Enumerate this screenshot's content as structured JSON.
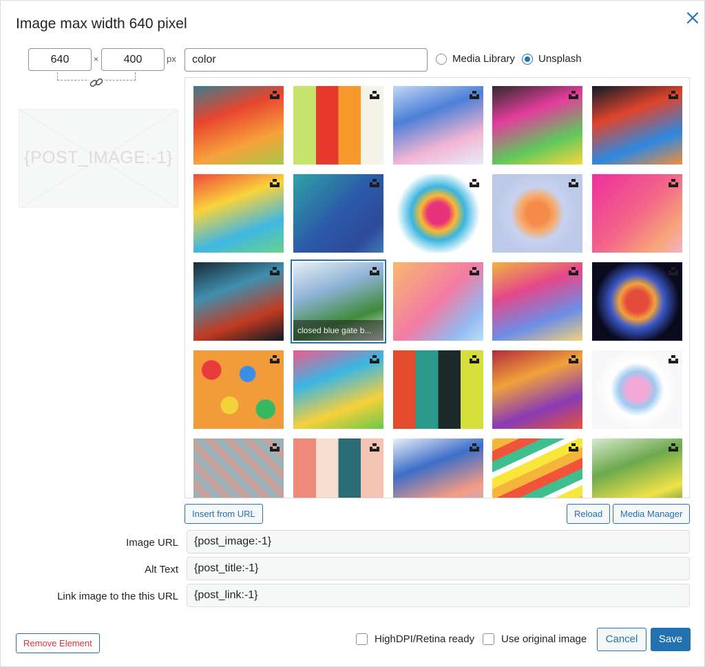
{
  "dialog": {
    "title": "Image max width 640 pixel",
    "close_icon": "close-icon"
  },
  "size": {
    "width": "640",
    "height": "400",
    "times": "×",
    "unit": "px",
    "link_icon": "chain-link-icon"
  },
  "placeholder": {
    "text": "{POST_IMAGE:-1}"
  },
  "search": {
    "value": "color"
  },
  "source": {
    "options": [
      {
        "label": "Media Library",
        "selected": false
      },
      {
        "label": "Unsplash",
        "selected": true
      }
    ]
  },
  "gallery": {
    "badge_icon": "unsplash-logo-icon",
    "selected_caption": "closed blue gate b...",
    "images": [
      {
        "colors": [
          "#3b7c8c",
          "#e8452f",
          "#f7a23b",
          "#a7c84a"
        ],
        "style": "tunnel"
      },
      {
        "colors": [
          "#c6e36b",
          "#e6392b",
          "#f79a2b",
          "#f3f3e8"
        ],
        "style": "stripes"
      },
      {
        "colors": [
          "#bfd8f3",
          "#4d7fd8",
          "#f2b5d3",
          "#e5eef8"
        ],
        "style": "swirl"
      },
      {
        "colors": [
          "#2f2a2a",
          "#e43c9c",
          "#5fc85d",
          "#f7d63b"
        ],
        "style": "windows"
      },
      {
        "colors": [
          "#0d1b2a",
          "#e0442b",
          "#2e88e0",
          "#f28e3b"
        ],
        "style": "smoke"
      },
      {
        "colors": [
          "#f0493a",
          "#f9d33b",
          "#3fb7e3",
          "#6ad28a"
        ],
        "style": "powder"
      },
      {
        "colors": [
          "#2fa3a6",
          "#2b5aa8",
          "#2f4a9a",
          "#3e7bb6"
        ],
        "style": "gradient"
      },
      {
        "colors": [
          "#ffffff",
          "#e8327a",
          "#f8b931",
          "#39b5e0"
        ],
        "style": "flower"
      },
      {
        "colors": [
          "#bcc9e8",
          "#f58b4a",
          "#f6ab6c",
          "#c7d2ef"
        ],
        "style": "blur"
      },
      {
        "colors": [
          "#ee2f9c",
          "#f3658a",
          "#f7a47a",
          "#f5b3c3"
        ],
        "style": "gradient2"
      },
      {
        "colors": [
          "#1a2a35",
          "#3f8fae",
          "#c23a21",
          "#0e1a22"
        ],
        "style": "smoke2"
      },
      {
        "colors": [
          "#e8eef3",
          "#8fb4d8",
          "#3f8a3a",
          "#f3f3f3"
        ],
        "style": "street"
      },
      {
        "colors": [
          "#f7b96d",
          "#f47ba4",
          "#94b8f0",
          "#b8e0f4"
        ],
        "style": "gradient3"
      },
      {
        "colors": [
          "#f0b53d",
          "#e5478b",
          "#6c8ee6",
          "#f4d17a"
        ],
        "style": "liquid"
      },
      {
        "colors": [
          "#0a0a1e",
          "#e44b3a",
          "#f0a23c",
          "#3a58c8"
        ],
        "style": "bokeh"
      },
      {
        "colors": [
          "#e83b3b",
          "#3a8ee6",
          "#f4d23b",
          "#35b860"
        ],
        "style": "balls"
      },
      {
        "colors": [
          "#f05a8c",
          "#3bb6e3",
          "#f7d03b",
          "#6bc84a"
        ],
        "style": "marble"
      },
      {
        "colors": [
          "#e34b2b",
          "#2b9a8c",
          "#1e2a2a",
          "#d6de3b"
        ],
        "style": "bars"
      },
      {
        "colors": [
          "#b32b3b",
          "#f0a23b",
          "#8a3ab5",
          "#e6543b"
        ],
        "style": "leaves"
      },
      {
        "colors": [
          "#f7f7f9",
          "#f2a9d8",
          "#9fc8f0",
          "#ffffff"
        ],
        "style": "ink"
      },
      {
        "colors": [
          "#9bb1b8",
          "#c7a09a",
          "#6e8d99",
          "#d3c1b0"
        ],
        "style": "tiles"
      },
      {
        "colors": [
          "#ef8a7b",
          "#f7ddcd",
          "#2a6b74",
          "#f3c4b3"
        ],
        "style": "wall"
      },
      {
        "colors": [
          "#e9eef8",
          "#3c6ec8",
          "#f59b83",
          "#9ec0ea"
        ],
        "style": "clouds"
      },
      {
        "colors": [
          "#f2533b",
          "#f5b53b",
          "#f8e63b",
          "#3fbf8f"
        ],
        "style": "rainbow"
      },
      {
        "colors": [
          "#d8e8cf",
          "#6ca94c",
          "#f0e24a",
          "#2f6d3a"
        ],
        "style": "greens"
      }
    ]
  },
  "actions": {
    "insert_from_url": "Insert from URL",
    "reload": "Reload",
    "media_manager": "Media Manager"
  },
  "fields": {
    "image_url": {
      "label": "Image URL",
      "value": "{post_image:-1}"
    },
    "alt_text": {
      "label": "Alt Text",
      "value": "{post_title:-1}"
    },
    "link_url": {
      "label": "Link image to the this URL",
      "value": "{post_link:-1}"
    }
  },
  "footer": {
    "remove": "Remove Element",
    "highdpi": "HighDPI/Retina ready",
    "original": "Use original image",
    "cancel": "Cancel",
    "save": "Save"
  },
  "colors": {
    "accent": "#2271b1",
    "danger": "#d63638"
  }
}
